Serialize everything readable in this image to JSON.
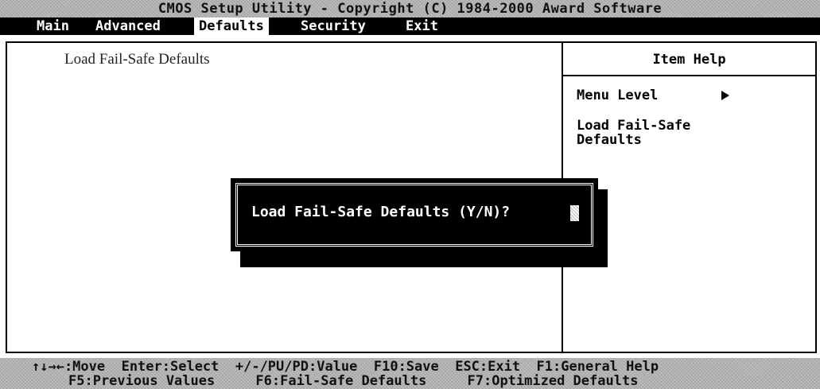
{
  "title": "CMOS Setup Utility - Copyright (C) 1984-2000 Award Software",
  "menu": {
    "items": [
      {
        "label": "Main"
      },
      {
        "label": "Advanced"
      },
      {
        "label": "Defaults",
        "active": true
      },
      {
        "label": "Security"
      },
      {
        "label": "Exit"
      }
    ]
  },
  "main": {
    "selected_item": "Load Fail-Safe Defaults"
  },
  "help": {
    "title": "Item Help",
    "menu_level": "Menu Level",
    "description_line1": "Load Fail-Safe",
    "description_line2": "Defaults"
  },
  "dialog": {
    "prompt": "Load Fail-Safe Defaults (Y/N)?"
  },
  "footer": {
    "line1": "↑↓→←:Move  Enter:Select  +/-/PU/PD:Value  F10:Save  ESC:Exit  F1:General Help",
    "line2": "F5:Previous Values     F6:Fail-Safe Defaults     F7:Optimized Defaults"
  },
  "icons": {
    "menu_level": "triangle-right-icon"
  },
  "colors": {
    "background": "#ffffff",
    "menubar": "#000000",
    "dither": "#bdbdbd"
  }
}
